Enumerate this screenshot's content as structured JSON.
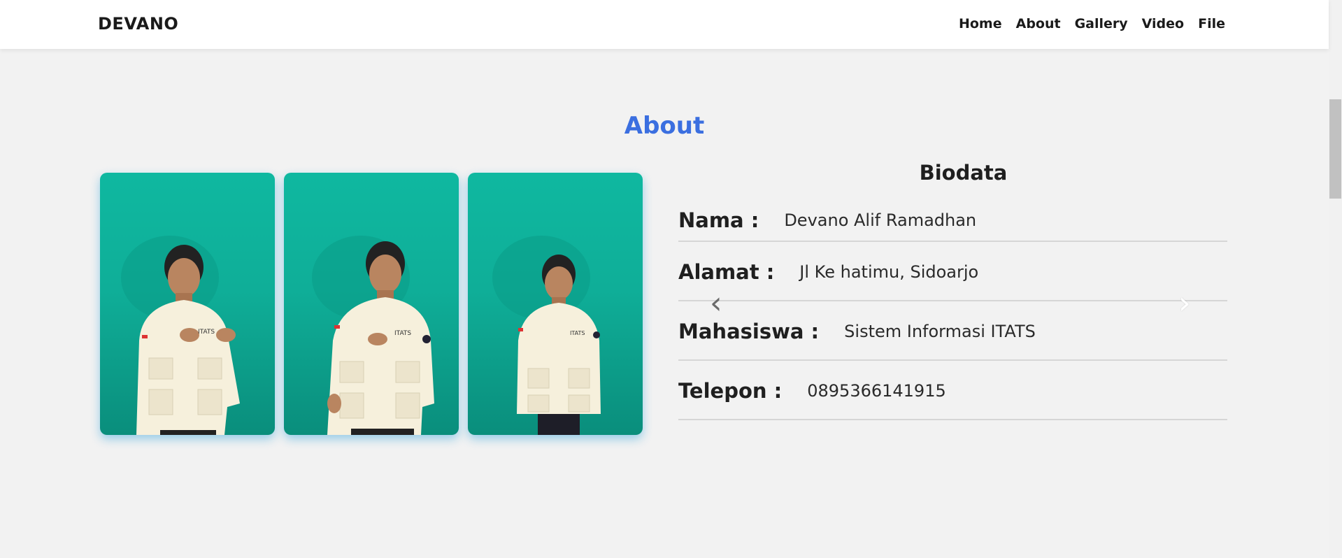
{
  "navbar": {
    "brand": "DEVANO",
    "links": [
      {
        "label": "Home"
      },
      {
        "label": "About"
      },
      {
        "label": "Gallery"
      },
      {
        "label": "Video"
      },
      {
        "label": "File"
      }
    ]
  },
  "about": {
    "title": "About",
    "photos": [
      {
        "name": "photo-hands-on-chest"
      },
      {
        "name": "photo-pointing-pose"
      },
      {
        "name": "photo-standing-pose"
      }
    ],
    "biodata": {
      "title": "Biodata",
      "rows": [
        {
          "label": "Nama :",
          "value": "Devano Alif Ramadhan"
        },
        {
          "label": "Alamat :",
          "value": "Jl Ke hatimu, Sidoarjo"
        },
        {
          "label": "Mahasiswa :",
          "value": "Sistem Informasi ITATS"
        },
        {
          "label": "Telepon :",
          "value": "0895366141915"
        }
      ]
    },
    "carousel": {
      "prev_icon": "chevron-left-icon",
      "next_icon": "chevron-right-icon",
      "prev_glyph": "‹",
      "next_glyph": "›"
    }
  },
  "colors": {
    "accent": "#3b6fe0",
    "photo_background": "#0fb8a0",
    "page_background": "#f2f2f2"
  }
}
